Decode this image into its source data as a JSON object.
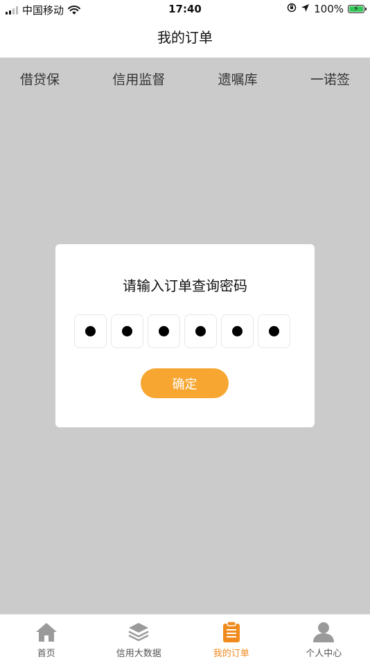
{
  "status_bar": {
    "carrier": "中国移动",
    "time": "17:40",
    "battery_text": "100%",
    "icons": [
      "signal-icon",
      "wifi-icon",
      "orientation-lock-icon",
      "location-icon",
      "battery-charging-icon"
    ]
  },
  "header": {
    "title": "我的订单"
  },
  "category_tabs": [
    {
      "label": "借贷保"
    },
    {
      "label": "信用监督"
    },
    {
      "label": "遗嘱库"
    },
    {
      "label": "一诺签"
    }
  ],
  "modal": {
    "title": "请输入订单查询密码",
    "password_digits_filled": 6,
    "password_length": 6,
    "confirm_label": "确定"
  },
  "tab_bar": {
    "items": [
      {
        "label": "首页",
        "icon": "home-icon",
        "active": false
      },
      {
        "label": "信用大数据",
        "icon": "layers-icon",
        "active": false
      },
      {
        "label": "我的订单",
        "icon": "clipboard-icon",
        "active": true
      },
      {
        "label": "个人中心",
        "icon": "user-icon",
        "active": false
      }
    ]
  },
  "colors": {
    "accent": "#f7a631",
    "tab_active": "#f08a1c",
    "overlay": "#cbcbcb",
    "battery": "#35c759"
  }
}
